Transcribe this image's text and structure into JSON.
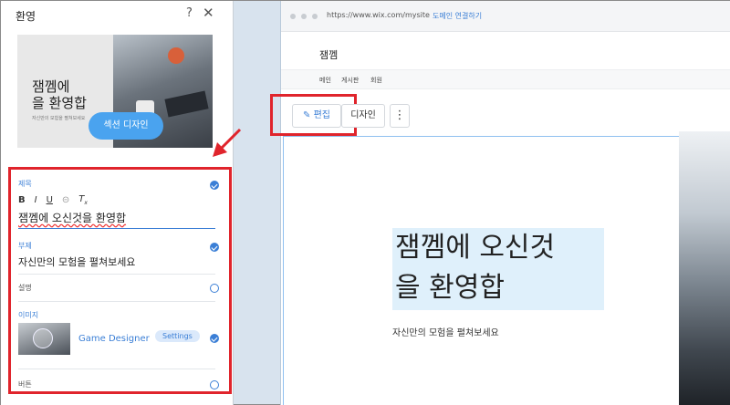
{
  "panel": {
    "title": "환영",
    "help": "?",
    "close": "✕",
    "preview": {
      "heading": "잼껨에\n을 환영합",
      "sub": "자신만의 모험을 펼쳐보세요",
      "section_design_button": "섹션 디자인"
    },
    "fields": {
      "title": {
        "label": "제목",
        "toolbar": [
          "B",
          "I",
          "U",
          "⊝",
          "Tx"
        ],
        "value": "잼껨에 오신것을 환영합"
      },
      "subtitle": {
        "label": "부제",
        "value": "자신만의 모험을 펼쳐보세요"
      },
      "description": {
        "label": "설명"
      },
      "image": {
        "label": "이미지",
        "name": "Game Designer",
        "settings": "Settings"
      },
      "button": {
        "label": "버튼"
      }
    }
  },
  "browser": {
    "url": "https://www.wix.com/mysite",
    "connect_domain": "도메인 연결하기",
    "site_name": "잼껨",
    "nav": [
      "메인",
      "게시판",
      "회원"
    ],
    "edit_button": "편집",
    "design_button": "디자인",
    "more_button": "⋮",
    "hero_heading_line1": "잼껨에 오신것",
    "hero_heading_line2": "을 환영합",
    "hero_sub": "자신만의 모험을 펼쳐보세요"
  },
  "colors": {
    "accent": "#3b7fd6",
    "highlight": "#e0242c",
    "canvas": "#d8e3ee"
  }
}
